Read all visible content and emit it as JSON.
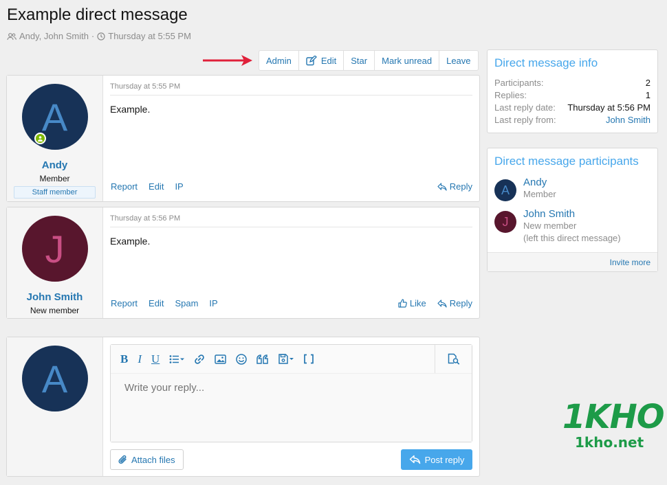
{
  "header": {
    "title": "Example direct message",
    "participants_text": "Andy, John Smith",
    "separator": "·",
    "date_text": "Thursday at 5:55 PM"
  },
  "toolbar": {
    "admin_label": "Admin",
    "edit_label": "Edit",
    "star_label": "Star",
    "mark_unread_label": "Mark unread",
    "leave_label": "Leave"
  },
  "messages": [
    {
      "avatar_letter": "A",
      "username": "Andy",
      "user_title": "Member",
      "banner": "Staff member",
      "date": "Thursday at 5:55 PM",
      "text": "Example.",
      "actions": {
        "report": "Report",
        "edit": "Edit",
        "ip": "IP",
        "reply": "Reply"
      }
    },
    {
      "avatar_letter": "J",
      "username": "John Smith",
      "user_title": "New member",
      "date": "Thursday at 5:56 PM",
      "text": "Example.",
      "actions": {
        "report": "Report",
        "edit": "Edit",
        "spam": "Spam",
        "ip": "IP",
        "like": "Like",
        "reply": "Reply"
      }
    }
  ],
  "info": {
    "title": "Direct message info",
    "rows": [
      {
        "label": "Participants:",
        "value": "2"
      },
      {
        "label": "Replies:",
        "value": "1"
      },
      {
        "label": "Last reply date:",
        "value": "Thursday at 5:56 PM"
      },
      {
        "label": "Last reply from:",
        "value": "John Smith"
      }
    ]
  },
  "participants": {
    "title": "Direct message participants",
    "items": [
      {
        "letter": "A",
        "name": "Andy",
        "title": "Member"
      },
      {
        "letter": "J",
        "name": "John Smith",
        "title": "New member",
        "note": "(left this direct message)"
      }
    ],
    "invite_label": "Invite more"
  },
  "reply": {
    "avatar_letter": "A",
    "placeholder": "Write your reply...",
    "attach_label": "Attach files",
    "post_label": "Post reply"
  },
  "watermark": {
    "logo": "1KHO",
    "site": "1kho.net"
  },
  "colors": {
    "link": "#2577b1",
    "accent": "#47a7eb",
    "avatar_a_bg": "#173257",
    "avatar_j_bg": "#58162d",
    "online": "#7fb900",
    "arrow": "#e0203a"
  }
}
